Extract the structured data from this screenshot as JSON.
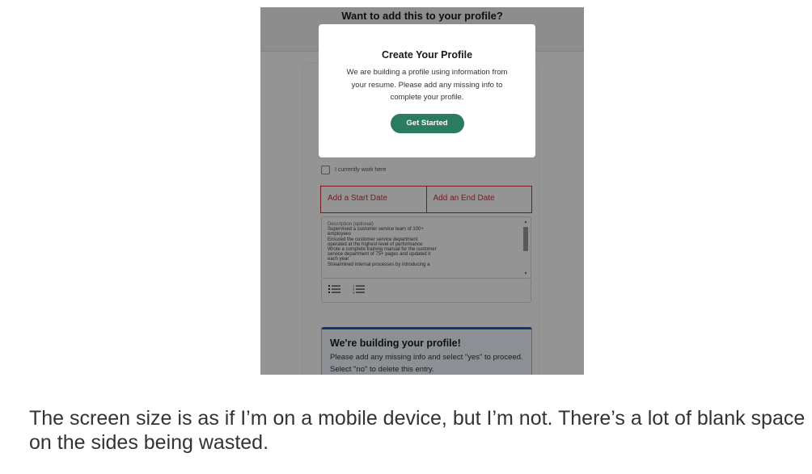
{
  "screenshot": {
    "topbar_title": "Want to add this to your profile?",
    "checkbox_label": "I currently work here",
    "start_date_placeholder": "Add a Start Date",
    "end_date_placeholder": "Add an End Date",
    "description_label": "Description (optional)",
    "description_text": "Supervised a customer service team of 100+\nemployees\nEnsured the customer service department\noperated at the highest level of performance\nWrote a complete training manual for the customer\nservice department of 75+ pages and updated it\neach year\nStreamlined internal processes by introducing a",
    "toolbar_icons": [
      "bullet-list-icon",
      "numbered-list-icon"
    ],
    "banner": {
      "title": "We're building your profile!",
      "text": "Please add any missing info and select \"yes\" to proceed. Select \"no\" to delete this entry."
    },
    "modal": {
      "title": "Create Your Profile",
      "body": "We are building a profile using information from your resume. Please add any missing info to complete your profile.",
      "button_label": "Get Started"
    },
    "colors": {
      "accent_green": "#2b7b5e",
      "error_red": "#d32f2f",
      "banner_blue": "#1565c0"
    }
  },
  "caption": "The screen size is as if I’m on a mobile device, but I’m not. There’s a lot of blank space on the sides being wasted."
}
